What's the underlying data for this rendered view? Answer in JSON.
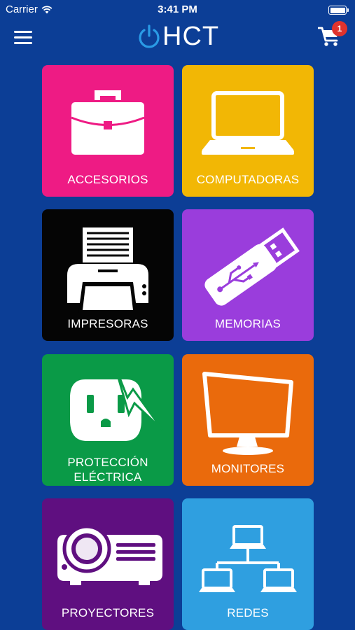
{
  "status_bar": {
    "carrier": "Carrier",
    "time": "3:41 PM"
  },
  "header": {
    "logo_text": "HCT",
    "cart_count": "1"
  },
  "colors": {
    "background": "#0c3e96",
    "accesorios": "#ee1b84",
    "computadoras": "#f2b705",
    "impresoras": "#050505",
    "memorias": "#9a3ddc",
    "proteccion": "#0a9a47",
    "monitores": "#ea6a0c",
    "proyectores": "#5f0f80",
    "redes": "#2f9fe0"
  },
  "categories": [
    {
      "label": "ACCESORIOS",
      "icon": "briefcase-icon"
    },
    {
      "label": "COMPUTADORAS",
      "icon": "laptop-icon"
    },
    {
      "label": "IMPRESORAS",
      "icon": "printer-icon"
    },
    {
      "label": "MEMORIAS",
      "icon": "usb-drive-icon"
    },
    {
      "label_line1": "PROTECCIÓN",
      "label_line2": "ELÉCTRICA",
      "icon": "power-outlet-icon"
    },
    {
      "label": "MONITORES",
      "icon": "monitor-icon"
    },
    {
      "label": "PROYECTORES",
      "icon": "projector-icon"
    },
    {
      "label": "REDES",
      "icon": "network-icon"
    }
  ]
}
